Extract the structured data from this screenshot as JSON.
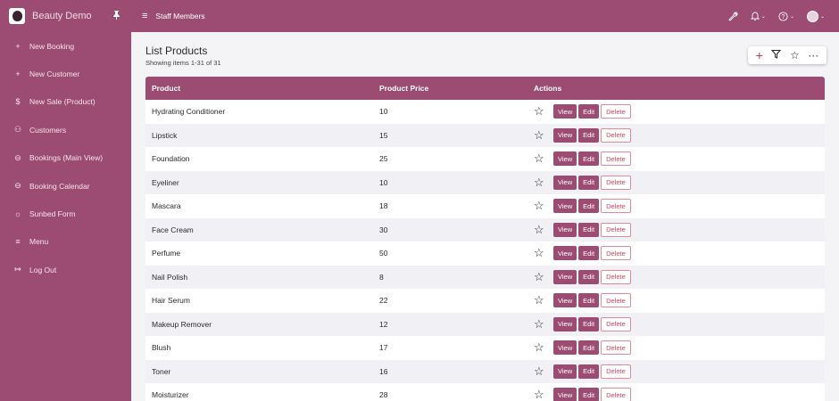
{
  "sidebar": {
    "brand": "Beauty Demo",
    "items": [
      {
        "label": "New Booking",
        "icon": "plus-icon"
      },
      {
        "label": "New Customer",
        "icon": "plus-icon"
      },
      {
        "label": "New Sale (Product)",
        "icon": "dollar-icon"
      },
      {
        "label": "Customers",
        "icon": "users-icon"
      },
      {
        "label": "Bookings (Main View)",
        "icon": "inbox-icon"
      },
      {
        "label": "Booking Calendar",
        "icon": "inbox-icon"
      },
      {
        "label": "Sunbed Form",
        "icon": "sun-icon"
      },
      {
        "label": "Menu",
        "icon": "menu-icon"
      },
      {
        "label": "Log Out",
        "icon": "logout-icon"
      }
    ]
  },
  "topbar": {
    "title": "Staff Members"
  },
  "page": {
    "title": "List Products",
    "subtitle": "Showing items 1-31 of 31"
  },
  "table": {
    "headers": {
      "product": "Product",
      "price": "Product Price",
      "actions": "Actions"
    },
    "buttons": {
      "view": "View",
      "edit": "Edit",
      "delete": "Delete"
    },
    "rows": [
      {
        "product": "Hydrating Conditioner",
        "price": "10"
      },
      {
        "product": "Lipstick",
        "price": "15"
      },
      {
        "product": "Foundation",
        "price": "25"
      },
      {
        "product": "Eyeliner",
        "price": "10"
      },
      {
        "product": "Mascara",
        "price": "18"
      },
      {
        "product": "Face Cream",
        "price": "30"
      },
      {
        "product": "Perfume",
        "price": "50"
      },
      {
        "product": "Nail Polish",
        "price": "8"
      },
      {
        "product": "Hair Serum",
        "price": "22"
      },
      {
        "product": "Makeup Remover",
        "price": "12"
      },
      {
        "product": "Blush",
        "price": "17"
      },
      {
        "product": "Toner",
        "price": "16"
      },
      {
        "product": "Moisturizer",
        "price": "28"
      }
    ]
  },
  "colors": {
    "brand": "#9c4b72",
    "delete": "#d9475c",
    "row_alt": "#f1f0f5"
  }
}
